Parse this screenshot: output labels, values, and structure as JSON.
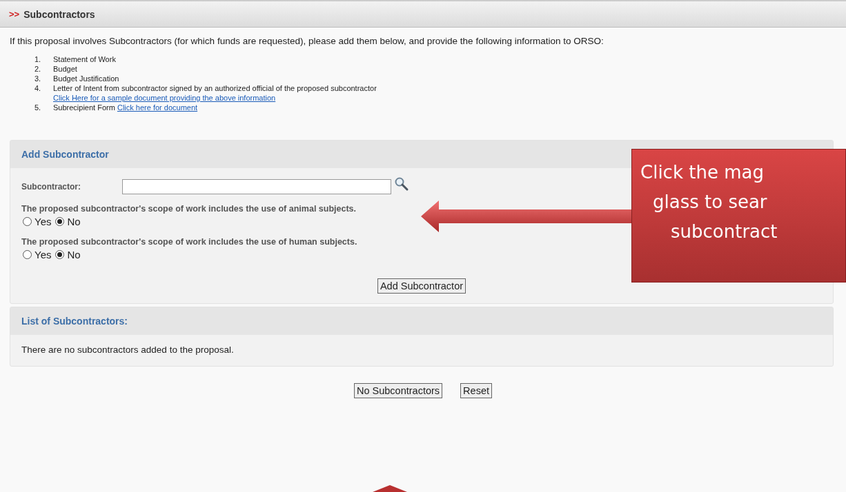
{
  "header": {
    "marker": ">>",
    "title": "Subcontractors"
  },
  "intro": "If this proposal involves Subcontractors (for which funds are requested), please add them below, and provide the following information to ORSO:",
  "requirements": [
    {
      "number": "1.",
      "text": "Statement of Work"
    },
    {
      "number": "2.",
      "text": "Budget"
    },
    {
      "number": "3.",
      "text": "Budget Justification"
    },
    {
      "number": "4.",
      "text": "Letter of Intent from subcontractor signed by an authorized official of the proposed subcontractor",
      "link_below": "Click Here for a sample document providing the above information"
    },
    {
      "number": "5.",
      "text": "Subrecipient Form",
      "link_inline": "Click here for document"
    }
  ],
  "add_panel": {
    "title": "Add Subcontractor",
    "field_label": "Subcontractor:",
    "questions": [
      {
        "text": "The proposed subcontractor's scope of work includes the use of animal subjects.",
        "options": [
          {
            "label": "Yes",
            "selected": false
          },
          {
            "label": "No",
            "selected": true
          }
        ]
      },
      {
        "text": "The proposed subcontractor's scope of work includes the use of human subjects.",
        "options": [
          {
            "label": "Yes",
            "selected": false
          },
          {
            "label": "No",
            "selected": true
          }
        ]
      }
    ],
    "button": "Add Subcontractor"
  },
  "list_panel": {
    "title": "List of Subcontractors:",
    "empty_text": "There are no subcontractors added to the proposal."
  },
  "buttons": [
    "No Subcontractors",
    "Reset"
  ],
  "callout": {
    "lines": [
      "Click the mag",
      "glass to sear",
      "subcontract"
    ]
  }
}
